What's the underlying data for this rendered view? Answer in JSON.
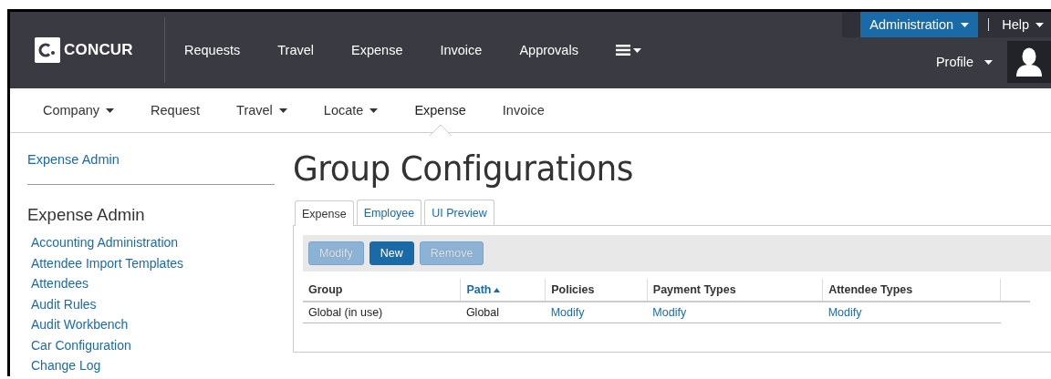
{
  "header": {
    "logo": "CONCUR",
    "nav": [
      {
        "label": "Requests"
      },
      {
        "label": "Travel"
      },
      {
        "label": "Expense"
      },
      {
        "label": "Invoice"
      },
      {
        "label": "Approvals"
      }
    ],
    "admin_menu": {
      "label": "Administration",
      "selected": true
    },
    "help_menu": {
      "label": "Help"
    },
    "profile_menu": {
      "label": "Profile"
    }
  },
  "subnav": [
    {
      "label": "Company",
      "dropdown": true,
      "selected": false
    },
    {
      "label": "Request",
      "dropdown": false,
      "selected": false
    },
    {
      "label": "Travel",
      "dropdown": true,
      "selected": false
    },
    {
      "label": "Locate",
      "dropdown": true,
      "selected": false
    },
    {
      "label": "Expense",
      "dropdown": false,
      "selected": true
    },
    {
      "label": "Invoice",
      "dropdown": false,
      "selected": false
    }
  ],
  "sidebar": {
    "breadcrumb": "Expense Admin",
    "heading": "Expense Admin",
    "items": [
      "Accounting Administration",
      "Attendee Import Templates",
      "Attendees",
      "Audit Rules",
      "Audit Workbench",
      "Car Configuration",
      "Change Log"
    ]
  },
  "page_title": "Group Configurations",
  "tabs": [
    {
      "label": "Expense",
      "selected": true
    },
    {
      "label": "Employee",
      "selected": false
    },
    {
      "label": "UI Preview",
      "selected": false
    }
  ],
  "toolbar": [
    {
      "label": "Modify",
      "disabled": true
    },
    {
      "label": "New",
      "disabled": false
    },
    {
      "label": "Remove",
      "disabled": true
    }
  ],
  "table": {
    "columns": [
      {
        "label": "Group",
        "sorted": false
      },
      {
        "label": "Path",
        "sorted": true
      },
      {
        "label": "Policies",
        "sorted": false
      },
      {
        "label": "Payment Types",
        "sorted": false
      },
      {
        "label": "Attendee Types",
        "sorted": false
      }
    ],
    "rows": [
      [
        {
          "kind": "text",
          "text": "Global (in use)"
        },
        {
          "kind": "text",
          "text": "Global"
        },
        {
          "kind": "link",
          "text": "Modify"
        },
        {
          "kind": "link",
          "text": "Modify"
        },
        {
          "kind": "link",
          "text": "Modify"
        }
      ]
    ]
  }
}
